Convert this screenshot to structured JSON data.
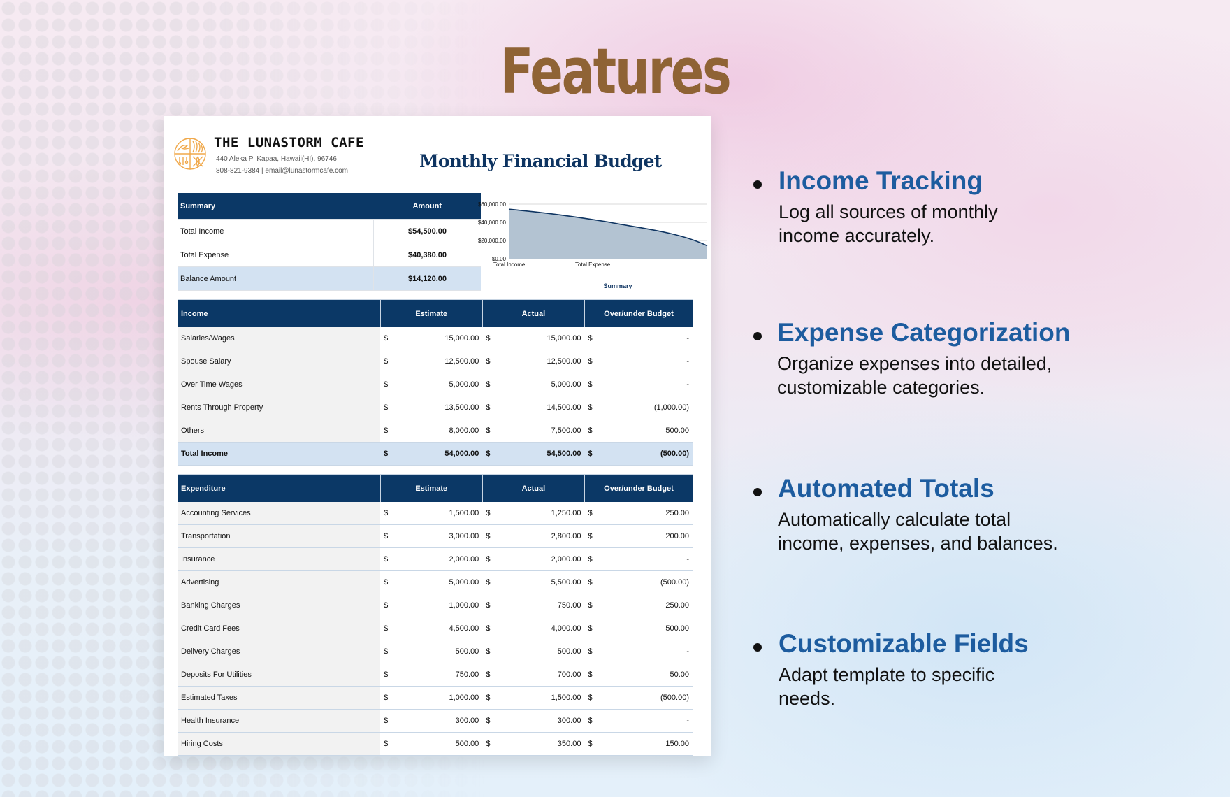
{
  "page": {
    "title": "Features"
  },
  "document": {
    "company": {
      "name": "THE LUNASTORM CAFE",
      "address": "440 Aleka Pl Kapaa, Hawaii(HI), 96746",
      "contact": "808-821-9384 | email@lunastormcafe.com",
      "logo_icon": "cafe-logo-icon",
      "logo_color": "#f0a84a"
    },
    "title": "Monthly Financial Budget",
    "summary": {
      "headers": [
        "Summary",
        "Amount"
      ],
      "rows": [
        {
          "label": "Total Income",
          "amount": "$54,500.00"
        },
        {
          "label": "Total Expense",
          "amount": "$40,380.00"
        },
        {
          "label": "Balance Amount",
          "amount": "$14,120.00"
        }
      ]
    },
    "income": {
      "headers": [
        "Income",
        "Estimate",
        "Actual",
        "Over/under Budget"
      ],
      "currency": "$",
      "rows": [
        {
          "name": "Salaries/Wages",
          "estimate": "15,000.00",
          "actual": "15,000.00",
          "diff": "-"
        },
        {
          "name": "Spouse Salary",
          "estimate": "12,500.00",
          "actual": "12,500.00",
          "diff": "-"
        },
        {
          "name": "Over Time Wages",
          "estimate": "5,000.00",
          "actual": "5,000.00",
          "diff": "-"
        },
        {
          "name": "Rents Through Property",
          "estimate": "13,500.00",
          "actual": "14,500.00",
          "diff": "(1,000.00)"
        },
        {
          "name": "Others",
          "estimate": "8,000.00",
          "actual": "7,500.00",
          "diff": "500.00"
        }
      ],
      "total": {
        "name": "Total Income",
        "estimate": "54,000.00",
        "actual": "54,500.00",
        "diff": "(500.00)"
      }
    },
    "expenditure": {
      "headers": [
        "Expenditure",
        "Estimate",
        "Actual",
        "Over/under Budget"
      ],
      "currency": "$",
      "rows": [
        {
          "name": "Accounting Services",
          "estimate": "1,500.00",
          "actual": "1,250.00",
          "diff": "250.00"
        },
        {
          "name": "Transportation",
          "estimate": "3,000.00",
          "actual": "2,800.00",
          "diff": "200.00"
        },
        {
          "name": "Insurance",
          "estimate": "2,000.00",
          "actual": "2,000.00",
          "diff": "-"
        },
        {
          "name": "Advertising",
          "estimate": "5,000.00",
          "actual": "5,500.00",
          "diff": "(500.00)"
        },
        {
          "name": "Banking Charges",
          "estimate": "1,000.00",
          "actual": "750.00",
          "diff": "250.00"
        },
        {
          "name": "Credit Card Fees",
          "estimate": "4,500.00",
          "actual": "4,000.00",
          "diff": "500.00"
        },
        {
          "name": "Delivery Charges",
          "estimate": "500.00",
          "actual": "500.00",
          "diff": "-"
        },
        {
          "name": "Deposits For Utilities",
          "estimate": "750.00",
          "actual": "700.00",
          "diff": "50.00"
        },
        {
          "name": "Estimated Taxes",
          "estimate": "1,000.00",
          "actual": "1,500.00",
          "diff": "(500.00)"
        },
        {
          "name": "Health Insurance",
          "estimate": "300.00",
          "actual": "300.00",
          "diff": "-"
        },
        {
          "name": "Hiring Costs",
          "estimate": "500.00",
          "actual": "350.00",
          "diff": "150.00"
        }
      ]
    }
  },
  "chart_data": {
    "type": "area",
    "title": "Summary",
    "categories": [
      "Total Income",
      "Total Expense",
      "Balance Amount"
    ],
    "tick_labels_x": [
      "Total Income",
      "Total Expense"
    ],
    "values": [
      54500,
      40380,
      14120
    ],
    "yticks": [
      "$0.00",
      "$20,000.00",
      "$40,000.00",
      "$60,000.00"
    ],
    "ylim": [
      0,
      60000
    ],
    "grid": true,
    "colors": {
      "fill": "#b3c3d2",
      "line": "#0e3461"
    }
  },
  "features": [
    {
      "title": "Income Tracking",
      "desc": "Log all sources of monthly income accurately."
    },
    {
      "title": "Expense Categorization",
      "desc": "Organize expenses into detailed, customizable categories."
    },
    {
      "title": "Automated Totals",
      "desc": "Automatically calculate total income, expenses, and balances."
    },
    {
      "title": "Customizable Fields",
      "desc": "Adapt template to specific needs."
    }
  ]
}
